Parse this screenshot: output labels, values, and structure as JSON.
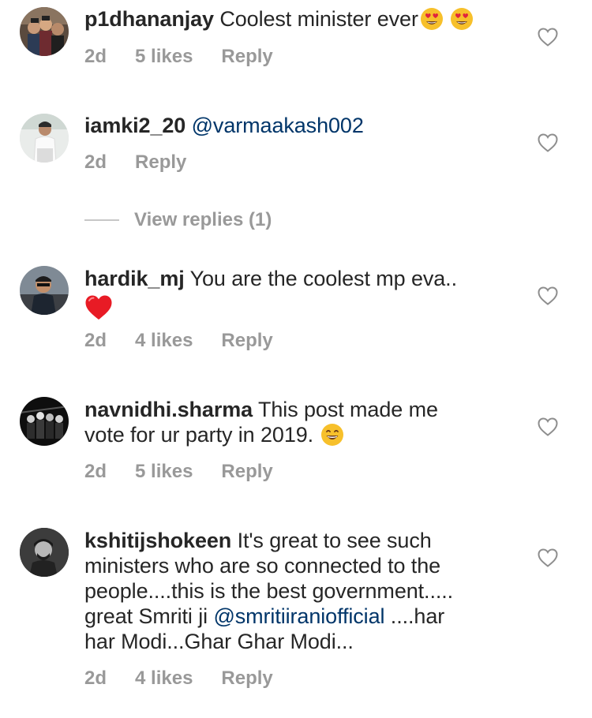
{
  "comments": [
    {
      "username": "p1dhananjay",
      "text": " Coolest minister ever",
      "time": "2d",
      "likes": "5 likes",
      "reply": "Reply"
    },
    {
      "username": "iamki2_20",
      "mention": "@varmaakash002",
      "time": "2d",
      "reply": "Reply",
      "view_replies": "View replies (1)"
    },
    {
      "username": "hardik_mj",
      "text": " You are the coolest mp eva..",
      "time": "2d",
      "likes": "4 likes",
      "reply": "Reply"
    },
    {
      "username": "navnidhi.sharma",
      "text_line1": " This post made me",
      "text_line2": "vote for ur party in 2019. ",
      "time": "2d",
      "likes": "5 likes",
      "reply": "Reply"
    },
    {
      "username": "kshitijshokeen",
      "text_line1": " It's great to see such",
      "text_line2": "ministers who are so connected to the",
      "text_line3": "people....this is the best government.....",
      "text_line4a": "great Smriti ji ",
      "mention": "@smritiiraniofficial",
      "text_line4b": " ....har",
      "text_line5": "har Modi...Ghar Ghar Modi...",
      "time": "2d",
      "likes": "4 likes",
      "reply": "Reply"
    }
  ],
  "icons": {
    "like": "heart-outline-icon",
    "emoji_heart_eyes": "heart-eyes-emoji",
    "emoji_red_heart": "red-heart-emoji",
    "emoji_grin": "grinning-emoji"
  },
  "colors": {
    "text": "#262626",
    "meta": "#999999",
    "mention": "#003569",
    "divider": "#c7c7c7"
  }
}
